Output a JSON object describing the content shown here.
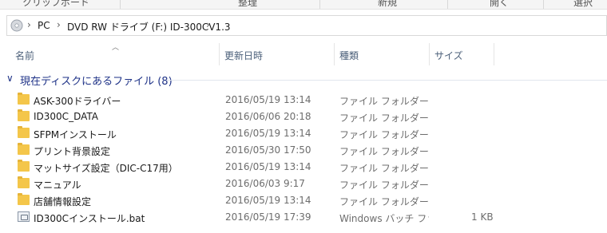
{
  "ribbon": {
    "items": [
      "クリップボード",
      "整理",
      "新規",
      "開く",
      "選択"
    ]
  },
  "address": {
    "drive_icon": "cd-drive-icon",
    "crumbs": [
      "PC",
      "DVD RW ドライブ (F:) ID-300CV1.3"
    ]
  },
  "columns": {
    "name": "名前",
    "date": "更新日時",
    "type": "種類",
    "size": "サイズ"
  },
  "group": {
    "title": "現在ディスクにあるファイル (8)"
  },
  "files": [
    {
      "name": "ASK-300ドライバー",
      "date": "2016/05/19 13:14",
      "type": "ファイル フォルダー",
      "size": "",
      "icon": "folder-icon"
    },
    {
      "name": "ID300C_DATA",
      "date": "2016/06/06 20:18",
      "type": "ファイル フォルダー",
      "size": "",
      "icon": "folder-icon"
    },
    {
      "name": "SFPMインストール",
      "date": "2016/05/19 13:14",
      "type": "ファイル フォルダー",
      "size": "",
      "icon": "folder-icon"
    },
    {
      "name": "プリント背景設定",
      "date": "2016/05/30 17:50",
      "type": "ファイル フォルダー",
      "size": "",
      "icon": "folder-icon"
    },
    {
      "name": "マットサイズ設定（DIC-C17用）",
      "date": "2016/05/19 13:14",
      "type": "ファイル フォルダー",
      "size": "",
      "icon": "folder-icon"
    },
    {
      "name": "マニュアル",
      "date": "2016/06/03 9:17",
      "type": "ファイル フォルダー",
      "size": "",
      "icon": "folder-icon"
    },
    {
      "name": "店舗情報設定",
      "date": "2016/05/19 13:14",
      "type": "ファイル フォルダー",
      "size": "",
      "icon": "folder-icon"
    },
    {
      "name": "ID300Cインストール.bat",
      "date": "2016/05/19 17:39",
      "type": "Windows バッチ ファイル",
      "size": "1 KB",
      "icon": "batch-file-icon"
    }
  ]
}
